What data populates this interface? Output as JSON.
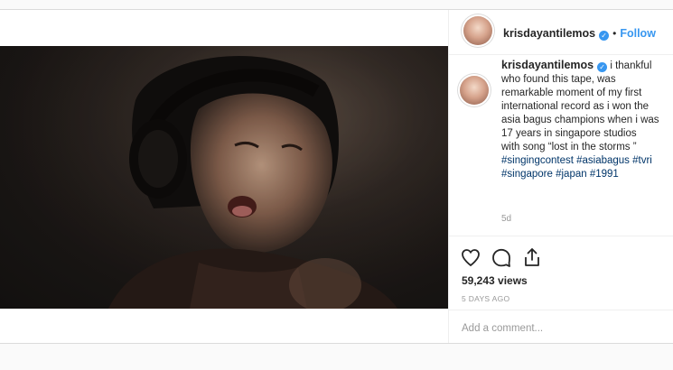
{
  "post": {
    "username": "krisdayantilemos",
    "follow_label": "Follow",
    "caption": {
      "body": "i thankful who found this tape, was remarkable moment of my first international record as i won the asia bagus champions when i was 17 years in singapore studios",
      "song_line": "with song “lost in the storms ”",
      "hashtags_line1": "#singingcontest #asiabagus #tvri",
      "hashtags_line2": "#singapore #japan #1991",
      "time_ago": "5d"
    },
    "views": "59,243 views",
    "date": "5 DAYS AGO",
    "comment": {
      "placeholder": "Add a comment..."
    }
  },
  "icons": {
    "like": "heart-icon",
    "comment": "comment-icon",
    "share": "share-icon",
    "verified": "verified-badge-icon"
  },
  "colors": {
    "link_blue": "#3897f0",
    "hashtag": "#003569",
    "muted": "#999999",
    "border": "#dbdbdb"
  }
}
